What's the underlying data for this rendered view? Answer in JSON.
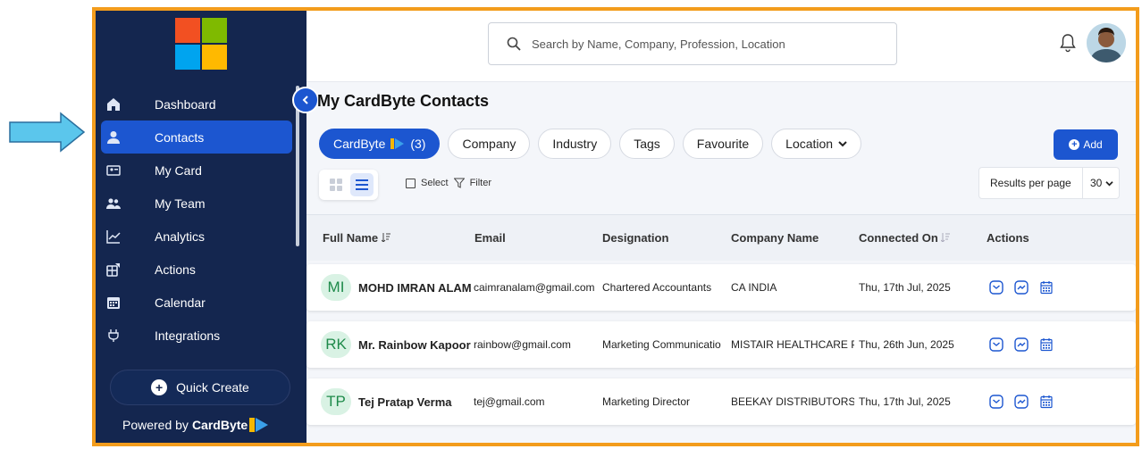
{
  "search": {
    "placeholder": "Search by Name, Company, Profession, Location"
  },
  "sidebar": {
    "items": [
      {
        "label": "Dashboard",
        "icon": "home-icon"
      },
      {
        "label": "Contacts",
        "icon": "person-icon",
        "active": true
      },
      {
        "label": "My Card",
        "icon": "id-card-icon"
      },
      {
        "label": "My Team",
        "icon": "team-icon"
      },
      {
        "label": "Analytics",
        "icon": "chart-line-icon"
      },
      {
        "label": "Actions",
        "icon": "actions-icon"
      },
      {
        "label": "Calendar",
        "icon": "calendar-icon"
      },
      {
        "label": "Integrations",
        "icon": "plug-icon"
      }
    ],
    "quick_create": "Quick Create",
    "powered_by": "Powered by",
    "brand": "CardByte"
  },
  "page": {
    "title": "My CardByte Contacts"
  },
  "filters": {
    "cardbyte": "CardByte",
    "cardbyte_count": "(3)",
    "company": "Company",
    "industry": "Industry",
    "tags": "Tags",
    "favourite": "Favourite",
    "location": "Location"
  },
  "toolbar": {
    "add": "Add",
    "select": "Select",
    "filter": "Filter",
    "results_per_page": "Results per page",
    "per_page_value": "30"
  },
  "table": {
    "headers": {
      "full_name": "Full Name",
      "email": "Email",
      "designation": "Designation",
      "company": "Company Name",
      "connected": "Connected On",
      "actions": "Actions"
    },
    "rows": [
      {
        "initials": "MI",
        "name": "MOHD IMRAN ALAM",
        "email": "caimranalam@gmail.com",
        "designation": "Chartered Accountants",
        "company": "CA INDIA",
        "connected": "Thu, 17th Jul, 2025"
      },
      {
        "initials": "RK",
        "name": "Mr. Rainbow Kapoor",
        "email": "rainbow@gmail.com",
        "designation": "Marketing Communicatio",
        "company": "MISTAIR HEALTHCARE PI",
        "connected": "Thu, 26th Jun, 2025"
      },
      {
        "initials": "TP",
        "name": "Tej Pratap Verma",
        "email": "tej@gmail.com",
        "designation": "Marketing Director",
        "company": "BEEKAY DISTRIBUTORS I",
        "connected": "Thu, 17th Jul, 2025"
      }
    ]
  },
  "colors": {
    "sidebar": "#14264f",
    "accent": "#1c56d0",
    "frame": "#f39c1c"
  }
}
